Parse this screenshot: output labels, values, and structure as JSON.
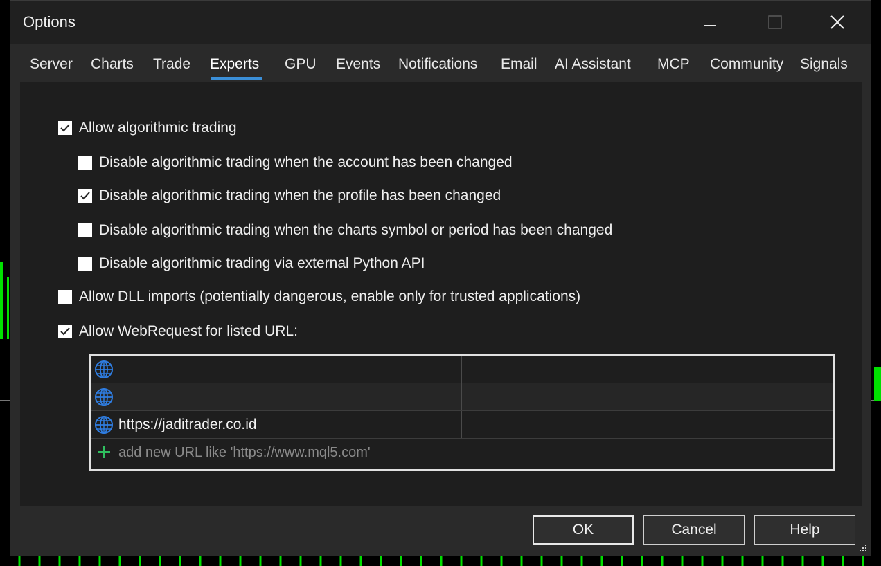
{
  "window": {
    "title": "Options"
  },
  "tabs": [
    {
      "label": "Server"
    },
    {
      "label": "Charts"
    },
    {
      "label": "Trade"
    },
    {
      "label": "Experts",
      "selected": true
    },
    {
      "label": "GPU"
    },
    {
      "label": "Events"
    },
    {
      "label": "Notifications"
    },
    {
      "label": "Email"
    },
    {
      "label": "AI Assistant"
    },
    {
      "label": "MCP"
    },
    {
      "label": "Community"
    },
    {
      "label": "Signals"
    }
  ],
  "options": [
    {
      "label": "Allow algorithmic trading",
      "checked": true
    },
    {
      "label": "Disable algorithmic trading when the account has been changed",
      "checked": false
    },
    {
      "label": "Disable algorithmic trading when the profile has been changed",
      "checked": true
    },
    {
      "label": "Disable algorithmic trading when the charts symbol or period has been changed",
      "checked": false
    },
    {
      "label": "Disable algorithmic trading via external Python API",
      "checked": false
    },
    {
      "label": "Allow DLL imports (potentially dangerous, enable only for trusted applications)",
      "checked": false
    },
    {
      "label": "Allow WebRequest for listed URL:",
      "checked": true
    }
  ],
  "url_list": {
    "rows": [
      {
        "url": ""
      },
      {
        "url": ""
      },
      {
        "url": "https://jaditrader.co.id"
      }
    ],
    "add_placeholder": "add new URL like 'https://www.mql5.com'"
  },
  "buttons": {
    "ok": "OK",
    "cancel": "Cancel",
    "help": "Help"
  },
  "colors": {
    "accent": "#3b8fd8",
    "dialog_bg": "#2a2a2a",
    "panel_bg": "#1e1e1e",
    "chart_green": "#00e000",
    "add_icon": "#2fbf5f",
    "globe": "#2f7de1"
  }
}
